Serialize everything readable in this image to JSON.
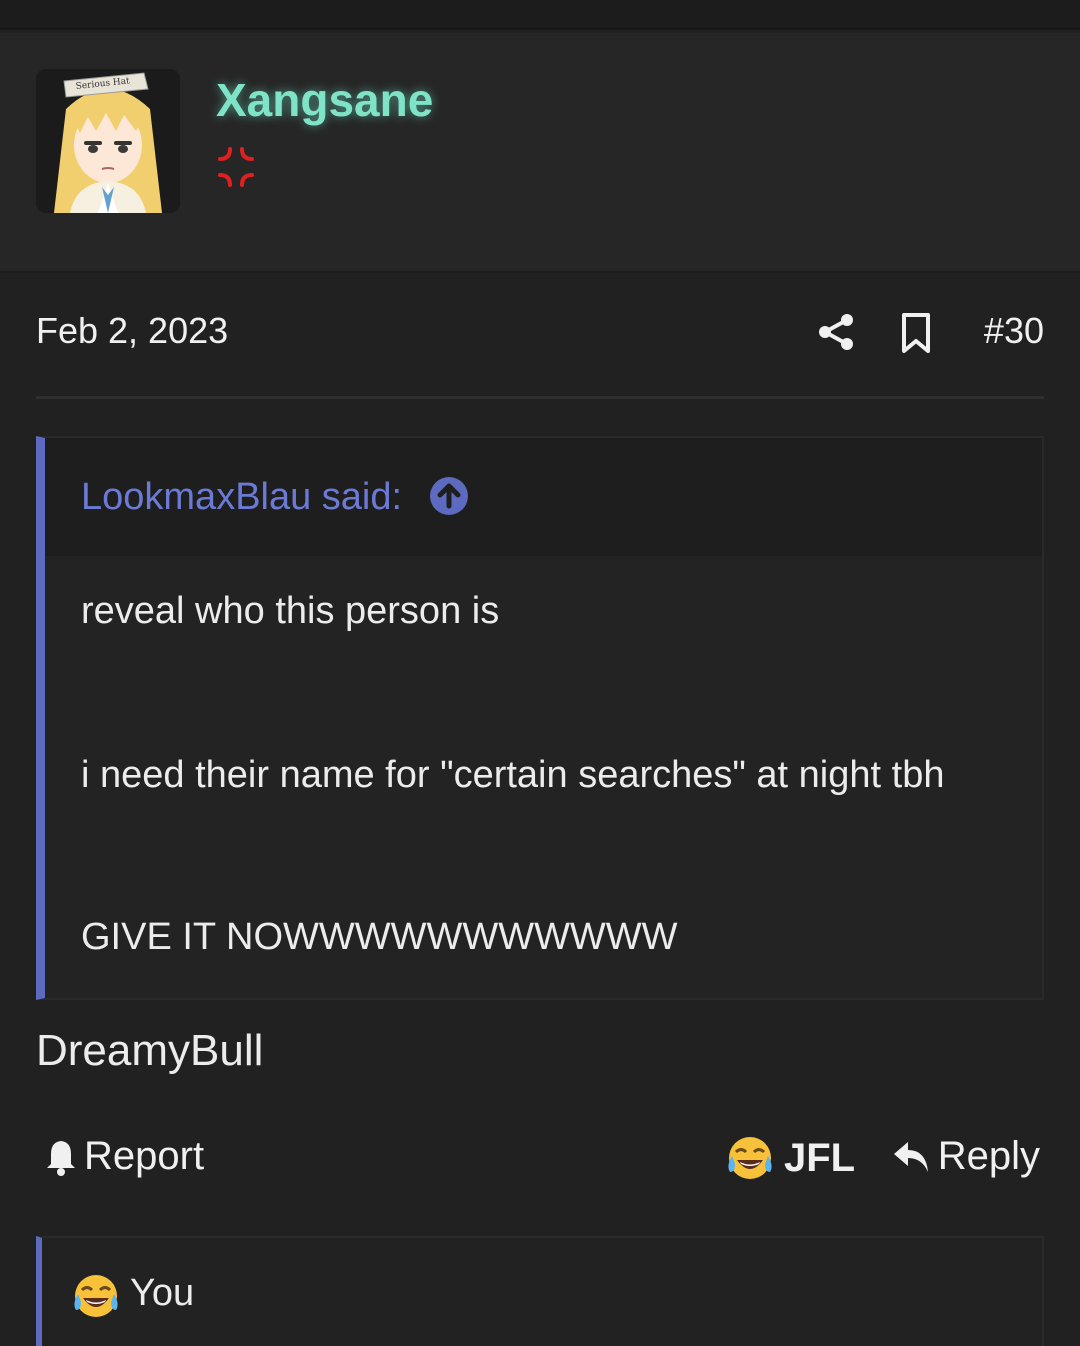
{
  "user": {
    "name": "Xangsane",
    "avatar_hat_text": "Serious Hat",
    "status_icon": "anger-symbol-icon"
  },
  "post": {
    "date": "Feb 2, 2023",
    "number": "#30",
    "quote": {
      "author_label": "LookmaxBlau said:",
      "lines": [
        "reveal who this person is",
        "i need their name for \"certain searches\" at night tbh",
        "GIVE IT NOWWWWWWWWWWW"
      ]
    },
    "body": "DreamyBull"
  },
  "actions": {
    "report_label": "Report",
    "jfl_label": "JFL",
    "reply_label": "Reply"
  },
  "reactions": {
    "user": "You"
  },
  "colors": {
    "accent": "#5c6bc0",
    "username": "#7fe3c8",
    "background": "#212121"
  }
}
